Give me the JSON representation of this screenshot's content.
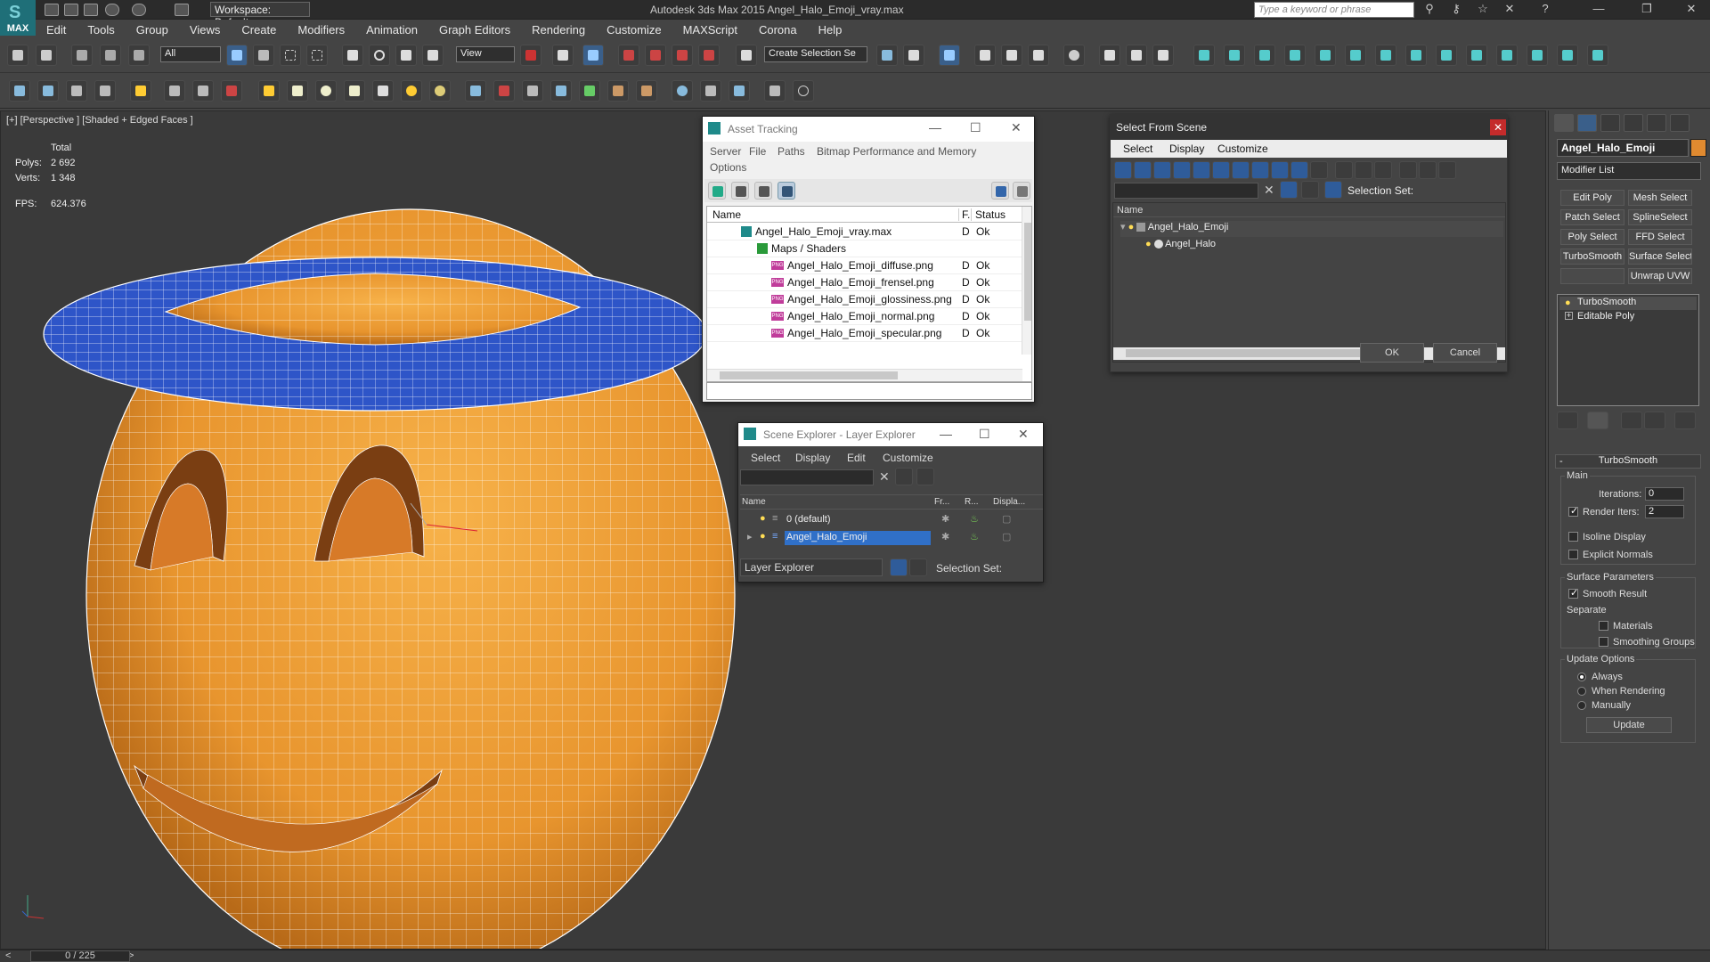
{
  "app": {
    "logo_text": "MAX",
    "title": "Autodesk 3ds Max  2015    Angel_Halo_Emoji_vray.max",
    "workspace": "Workspace: Default",
    "search_placeholder": "Type a keyword or phrase"
  },
  "menubar": [
    "Edit",
    "Tools",
    "Group",
    "Views",
    "Create",
    "Modifiers",
    "Animation",
    "Graph Editors",
    "Rendering",
    "Customize",
    "MAXScript",
    "Corona",
    "Help"
  ],
  "toolbar": {
    "selection_filter": "All",
    "ref_coord": "View",
    "named_selection": "Create Selection Se"
  },
  "viewport": {
    "label": "[+] [Perspective ] [Shaded + Edged Faces ]",
    "stats_total": "Total",
    "polys_label": "Polys:",
    "polys_value": "2 692",
    "verts_label": "Verts:",
    "verts_value": "1 348",
    "fps_label": "FPS:",
    "fps_value": "624.376"
  },
  "asset_tracking": {
    "title": "Asset Tracking",
    "menu": [
      "Server",
      "File",
      "Paths",
      "Bitmap Performance and Memory",
      "Options"
    ],
    "columns": [
      "Name",
      "F.",
      "Status"
    ],
    "rows": [
      {
        "name": "Angel_Halo_Emoji_vray.max",
        "f": "D",
        "status": "Ok"
      },
      {
        "name": "Maps / Shaders",
        "f": "",
        "status": ""
      },
      {
        "name": "Angel_Halo_Emoji_diffuse.png",
        "f": "D",
        "status": "Ok"
      },
      {
        "name": "Angel_Halo_Emoji_frensel.png",
        "f": "D",
        "status": "Ok"
      },
      {
        "name": "Angel_Halo_Emoji_glossiness.png",
        "f": "D",
        "status": "Ok"
      },
      {
        "name": "Angel_Halo_Emoji_normal.png",
        "f": "D",
        "status": "Ok"
      },
      {
        "name": "Angel_Halo_Emoji_specular.png",
        "f": "D",
        "status": "Ok"
      }
    ]
  },
  "select_from_scene": {
    "title": "Select From Scene",
    "menu": [
      "Select",
      "Display",
      "Customize"
    ],
    "selection_set": "Selection Set:",
    "column": "Name",
    "tree": [
      "Angel_Halo_Emoji",
      "Angel_Halo"
    ],
    "ok": "OK",
    "cancel": "Cancel"
  },
  "layer_explorer": {
    "title": "Scene Explorer - Layer Explorer",
    "menu": [
      "Select",
      "Display",
      "Edit",
      "Customize"
    ],
    "columns": [
      "Name",
      "Fr...",
      "R...",
      "Displa..."
    ],
    "rows": [
      "0 (default)",
      "Angel_Halo_Emoji"
    ],
    "footer_dropdown": "Layer Explorer",
    "selection_set": "Selection Set:"
  },
  "command_panel": {
    "object_name": "Angel_Halo_Emoji",
    "object_color": "#e08a30",
    "modifier_list": "Modifier List",
    "modifier_buttons": [
      "Edit Poly",
      "Mesh Select",
      "Patch Select",
      "SplineSelect",
      "Poly Select",
      "FFD Select",
      "TurboSmooth",
      "Surface Select",
      "",
      "Unwrap UVW"
    ],
    "stack": [
      "TurboSmooth",
      "Editable Poly"
    ],
    "rollout_title": "TurboSmooth",
    "main_group": "Main",
    "iterations_label": "Iterations:",
    "iterations_value": "0",
    "render_iters_label": "Render Iters:",
    "render_iters_value": "2",
    "isoline": "Isoline Display",
    "explicit_normals": "Explicit Normals",
    "surface_group": "Surface Parameters",
    "smooth_result": "Smooth Result",
    "separate": "Separate",
    "materials": "Materials",
    "smoothing_groups": "Smoothing Groups",
    "update_group": "Update Options",
    "always": "Always",
    "when_rendering": "When Rendering",
    "manually": "Manually",
    "update_button": "Update"
  },
  "timeline": {
    "frame": "0 / 225"
  }
}
